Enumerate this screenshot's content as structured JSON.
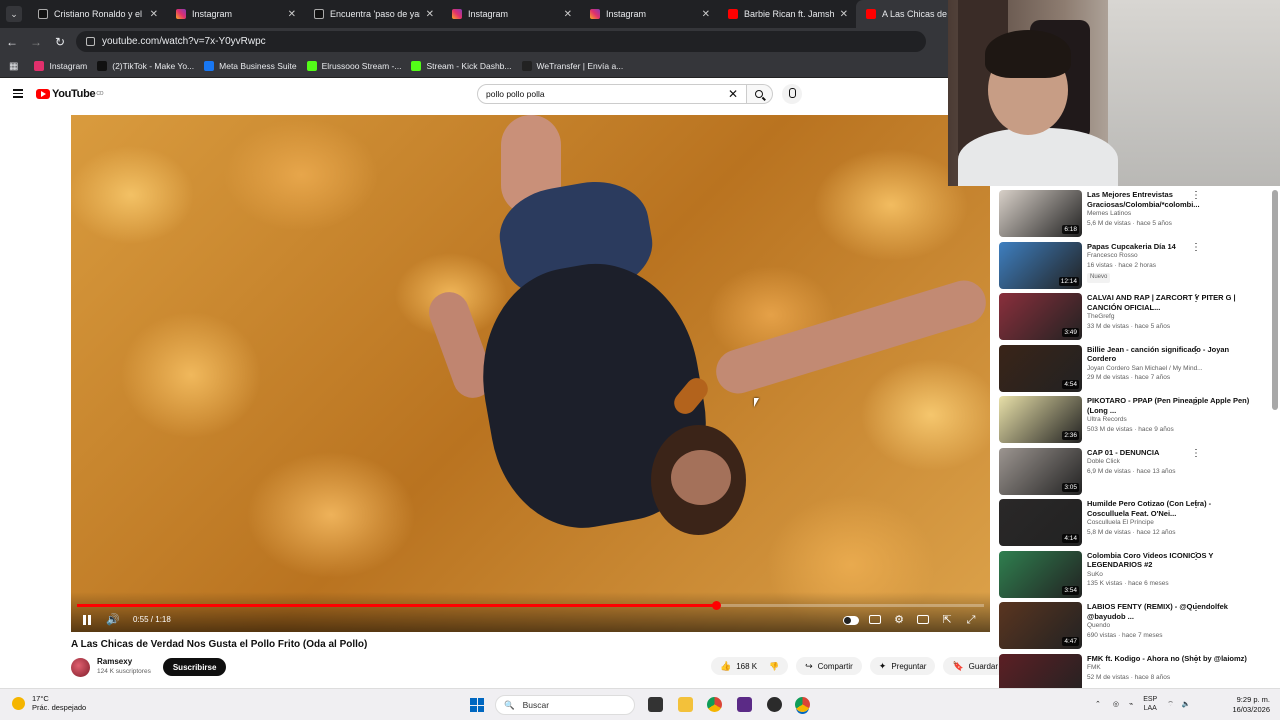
{
  "browser": {
    "tabs": [
      {
        "title": "Cristiano Ronaldo y el Hu",
        "fav": "tiktok-icon",
        "active": false
      },
      {
        "title": "Instagram",
        "fav": "instagram-icon",
        "active": false
      },
      {
        "title": "Encuentra 'paso de yama'",
        "fav": "tiktok-icon",
        "active": false
      },
      {
        "title": "Instagram",
        "fav": "instagram-icon",
        "active": false
      },
      {
        "title": "Instagram",
        "fav": "instagram-icon",
        "active": false
      },
      {
        "title": "Barbie Rican ft. Jamsha - ",
        "fav": "youtube-icon",
        "active": false
      },
      {
        "title": "A Las Chicas de Ve",
        "fav": "youtube-icon",
        "active": true
      }
    ],
    "url": "youtube.com/watch?v=7x-Y0yvRwpc",
    "bookmarks": [
      {
        "label": "Instagram",
        "color": "#e1306c"
      },
      {
        "label": "(2)TikTok - Make Yo...",
        "color": "#111111"
      },
      {
        "label": "Meta Business Suite",
        "color": "#1877f2"
      },
      {
        "label": "Elrussooo Stream -...",
        "color": "#53fc18"
      },
      {
        "label": "Stream - Kick Dashb...",
        "color": "#53fc18"
      },
      {
        "label": "WeTransfer | Envía a...",
        "color": "#222222"
      }
    ]
  },
  "youtube": {
    "logo": "YouTube",
    "logo_country": "CO",
    "search_value": "pollo pollo polla"
  },
  "player": {
    "current_time": "0:55 / 1:18",
    "progress": 0.705,
    "accent": "#ff0000"
  },
  "video": {
    "title": "A Las Chicas de Verdad Nos Gusta el Pollo Frito (Oda al Pollo)",
    "channel": "Ramsexy",
    "subscribers": "124 K suscriptores",
    "subscribe_label": "Suscribirse",
    "likes": "168 K",
    "share_label": "Compartir",
    "ask_label": "Preguntar",
    "save_label": "Guardar"
  },
  "recommendations": [
    {
      "title": "Las Mejores Entrevistas Graciosas/Colombia/*colombi...",
      "channel": "Memes Latinos",
      "meta": "5,6 M de vistas · hace 5 años",
      "duration": "6:18",
      "badge": "",
      "thumb_color": "#d8d0c8"
    },
    {
      "title": "Papas Cupcakeria Día 14",
      "channel": "Francesco Rosso",
      "meta": "16 vistas · hace 2 horas",
      "duration": "12:14",
      "badge": "Nuevo",
      "thumb_color": "#3e7fc0"
    },
    {
      "title": "CALVAI AND RAP | ZARCORT Y PITER G | CANCIÓN OFICIAL...",
      "channel": "TheGrefg",
      "meta": "33 M de vistas · hace 5 años",
      "duration": "3:49",
      "badge": "",
      "thumb_color": "#8a2f3c"
    },
    {
      "title": "Billie Jean - canción significado - Joyan Cordero",
      "channel": "Joyan Cordero San Michael / My Mind...",
      "meta": "29 M de vistas · hace 7 años",
      "duration": "4:54",
      "badge": "",
      "thumb_color": "#3a2418"
    },
    {
      "title": "PIKOTARO - PPAP (Pen Pineapple Apple Pen) (Long ...",
      "channel": "Ultra Records",
      "meta": "503 M de vistas · hace 9 años",
      "duration": "2:36",
      "badge": "",
      "thumb_color": "#e8e0a8"
    },
    {
      "title": "CAP 01 - DENUNCIA",
      "channel": "Doble Click",
      "meta": "6,9 M de vistas · hace 13 años",
      "duration": "3:05",
      "badge": "",
      "thumb_color": "#9c9590"
    },
    {
      "title": "Humilde Pero Cotizao (Con Letra) - Cosculluela Feat. O'Nei...",
      "channel": "Cosculluela El Príncipe",
      "meta": "5,8 M de vistas · hace 12 años",
      "duration": "4:14",
      "badge": "",
      "thumb_color": "#2a2828"
    },
    {
      "title": "Colombia Coro Videos ICONICOS Y LEGENDARIOS #2",
      "channel": "SuKo",
      "meta": "135 K vistas · hace 6 meses",
      "duration": "3:54",
      "badge": "",
      "thumb_color": "#2f7f4f"
    },
    {
      "title": "LABIOS FENTY (REMIX) - @Quendolfek @bayudob ...",
      "channel": "Quendo",
      "meta": "690 vistas · hace 7 meses",
      "duration": "4:47",
      "badge": "",
      "thumb_color": "#5a3520"
    },
    {
      "title": "FMK ft. Kodigo - Ahora no (Shot by @laiomz)",
      "channel": "FMK",
      "meta": "52 M de vistas · hace 8 años",
      "duration": "",
      "badge": "",
      "thumb_color": "#5c1f24"
    }
  ],
  "taskbar": {
    "temperature": "17°C",
    "weather_desc": "Prác. despejado",
    "search_label": "Buscar",
    "lang_top": "ESP",
    "lang_bottom": "LAA",
    "time": "9:29 p. m.",
    "date": "16/03/2026"
  }
}
